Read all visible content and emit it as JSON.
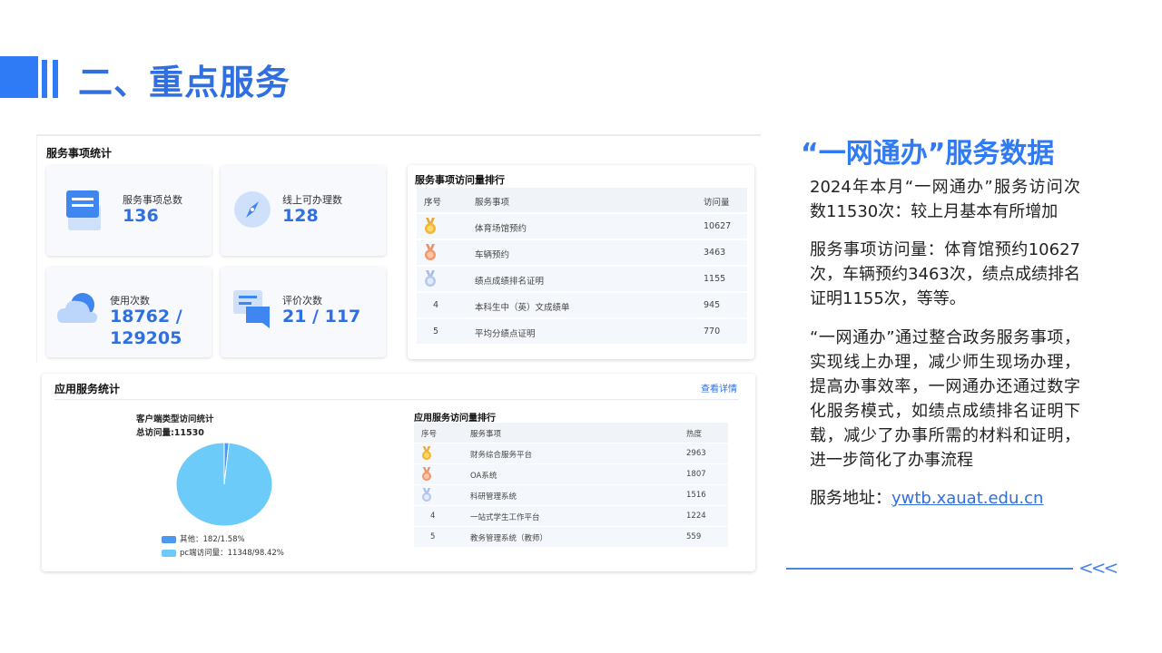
{
  "slide": {
    "title": "二、重点服务"
  },
  "service_stats": {
    "panel_title": "服务事项统计",
    "cards": [
      {
        "label": "服务事项总数",
        "value": "136",
        "icon": "form-icon"
      },
      {
        "label": "线上可办理数",
        "value": "128",
        "icon": "compass-icon"
      },
      {
        "label": "使用次数",
        "value_line1": "18762 /",
        "value_line2": "129205",
        "icon": "cloud-icon"
      },
      {
        "label": "评价次数",
        "value": "21 / 117",
        "icon": "chat-icon"
      }
    ]
  },
  "service_ranking": {
    "title": "服务事项访问量排行",
    "headers": {
      "rank": "序号",
      "item": "服务事项",
      "visits": "访问量"
    },
    "rows": [
      {
        "rank": "1",
        "medal": "gold",
        "item": "体育场馆预约",
        "visits": "10627"
      },
      {
        "rank": "2",
        "medal": "bronze",
        "item": "车辆预约",
        "visits": "3463"
      },
      {
        "rank": "3",
        "medal": "silver",
        "item": "绩点成绩排名证明",
        "visits": "1155"
      },
      {
        "rank": "4",
        "item": "本科生中（英）文成绩单",
        "visits": "945"
      },
      {
        "rank": "5",
        "item": "平均分绩点证明",
        "visits": "770"
      }
    ]
  },
  "app_stats": {
    "panel_title": "应用服务统计",
    "details_link": "查看详情",
    "pie": {
      "title": "客户端类型访问统计",
      "total": "总访问量:11530",
      "legend": [
        {
          "label": "其他：182/1.58%",
          "color": "#4a9af0"
        },
        {
          "label": "pc端访问量：11348/98.42%",
          "color": "#6ccbf8"
        }
      ]
    },
    "ranking": {
      "title": "应用服务访问量排行",
      "headers": {
        "rank": "序号",
        "item": "服务事项",
        "hot": "热度"
      },
      "rows": [
        {
          "rank": "1",
          "medal": "gold",
          "item": "财务综合服务平台",
          "hot": "2963"
        },
        {
          "rank": "2",
          "medal": "bronze",
          "item": "OA系统",
          "hot": "1807"
        },
        {
          "rank": "3",
          "medal": "silver",
          "item": "科研管理系统",
          "hot": "1516"
        },
        {
          "rank": "4",
          "item": "一站式学生工作平台",
          "hot": "1224"
        },
        {
          "rank": "5",
          "item": "教务管理系统（教师）",
          "hot": "559"
        }
      ]
    }
  },
  "chart_data": {
    "type": "pie",
    "title": "客户端类型访问统计",
    "categories": [
      "其他",
      "pc端访问量"
    ],
    "values": [
      182,
      11348
    ],
    "percentages": [
      1.58,
      98.42
    ],
    "colors": [
      "#4a9af0",
      "#6ccbf8"
    ]
  },
  "right_panel": {
    "heading": "“一网通办”服务数据",
    "para1": "2024年本月“一网通办”服务访问次数11530次：较上月基本有所增加",
    "para2": "服务事项访问量：体育馆预约10627次，车辆预约3463次，绩点成绩排名证明1155次，等等。",
    "para3": "“一网通办”通过整合政务服务事项，实现线上办理，减少师生现场办理，提高办事效率，一网通办还通过数字化服务模式，如绩点成绩排名证明下载，减少了办事所需的材料和证明，进一步简化了办事流程",
    "address_label": "服务地址：",
    "address_link": "ywtb.xauat.edu.cn",
    "chevrons": "<<<"
  }
}
